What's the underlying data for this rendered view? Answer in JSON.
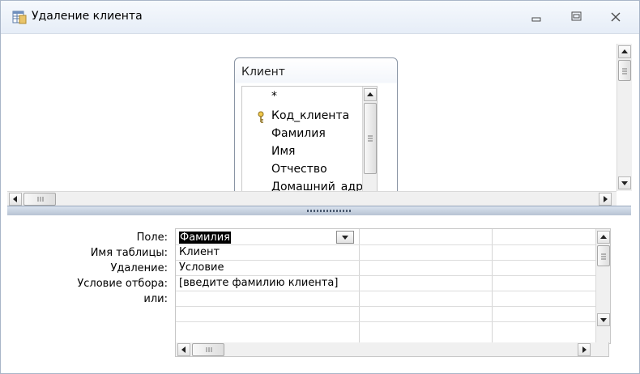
{
  "window": {
    "title": "Удаление клиента",
    "icons": {
      "app": "query-design-icon",
      "minimize": "minimize-icon",
      "maximize": "maximize-icon",
      "close": "close-icon"
    }
  },
  "diagram": {
    "table": {
      "name": "Клиент",
      "fields": [
        "*",
        "Код_клиента",
        "Фамилия",
        "Имя",
        "Отчество",
        "Домашний_адр"
      ],
      "primary_key_field": "Код_клиента"
    }
  },
  "grid": {
    "row_labels": {
      "field": "Поле:",
      "table": "Имя таблицы:",
      "delete": "Удаление:",
      "criteria": "Условие отбора:",
      "or": "или:"
    },
    "columns": [
      {
        "field": "Фамилия",
        "table": "Клиент",
        "delete": "Условие",
        "criteria": "[введите фамилию клиента]",
        "or": ""
      },
      {
        "field": "",
        "table": "",
        "delete": "",
        "criteria": "",
        "or": ""
      },
      {
        "field": "",
        "table": "",
        "delete": "",
        "criteria": "",
        "or": ""
      }
    ]
  },
  "colors": {
    "titlebar": "#e6edf7",
    "splitter": "#b7c3d3",
    "selection": "#000000"
  }
}
